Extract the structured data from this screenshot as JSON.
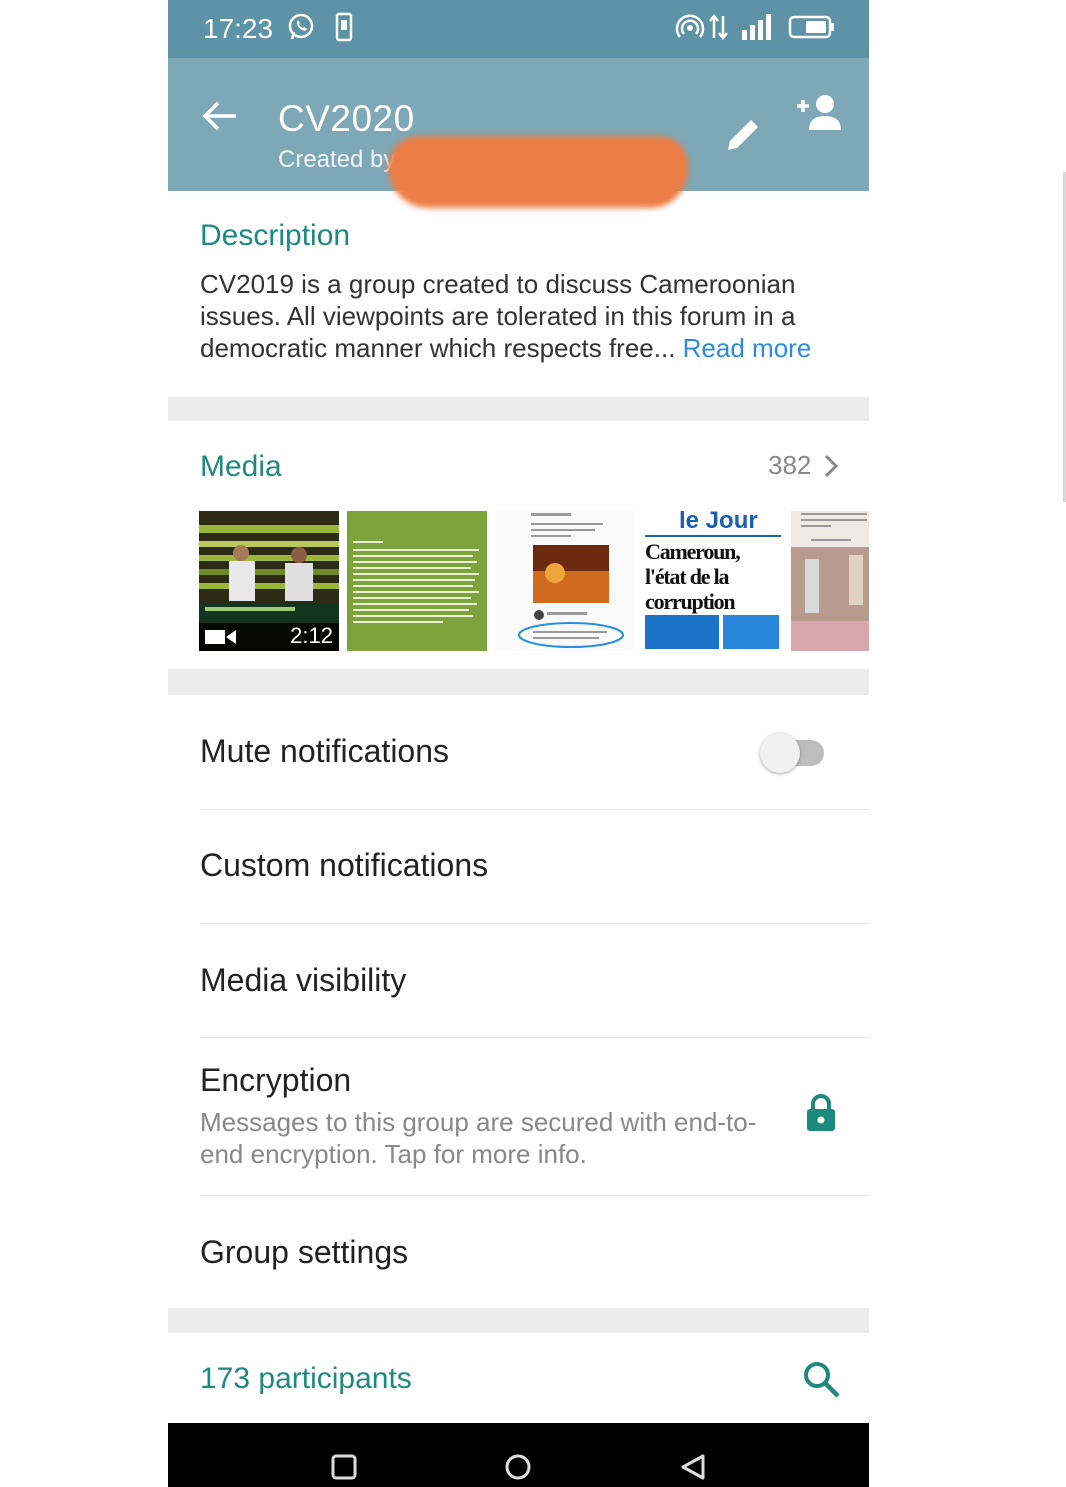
{
  "status_bar": {
    "time": "17:23",
    "icons": [
      "whatsapp-icon",
      "phone-notification-icon",
      "hotspot-icon",
      "data-arrows-icon",
      "signal-icon",
      "battery-icon"
    ]
  },
  "header": {
    "title": "CV2020",
    "subtitle": "Created by",
    "icons": [
      "back-arrow-icon",
      "edit-pencil-icon",
      "add-participant-icon"
    ]
  },
  "description": {
    "label": "Description",
    "text": "CV2019 is a group created to discuss Cameroonian issues. All viewpoints are tolerated in this forum in a democratic manner which respects free...",
    "read_more": "Read more"
  },
  "media": {
    "label": "Media",
    "count": "382",
    "thumbnails": [
      {
        "kind": "video",
        "duration": "2:12"
      },
      {
        "kind": "image",
        "text": ""
      },
      {
        "kind": "image",
        "text": ""
      },
      {
        "kind": "image",
        "headline_brand": "le Jour",
        "headline": "Cameroun, l'état de la corruption"
      },
      {
        "kind": "image",
        "text": ""
      }
    ]
  },
  "settings": {
    "mute_label": "Mute notifications",
    "mute_on": false,
    "custom_label": "Custom notifications",
    "visibility_label": "Media visibility",
    "encryption_label": "Encryption",
    "encryption_sub": "Messages to this group are secured with end-to-end encryption. Tap for more info.",
    "group_settings_label": "Group settings"
  },
  "participants": {
    "label": "173 participants"
  },
  "nav": [
    "recents-button",
    "home-button",
    "back-button"
  ],
  "colors": {
    "header": "#7ea8b6",
    "status_bar": "#5e92a6",
    "teal": "#1e8a7e",
    "link": "#2a8ee0"
  }
}
